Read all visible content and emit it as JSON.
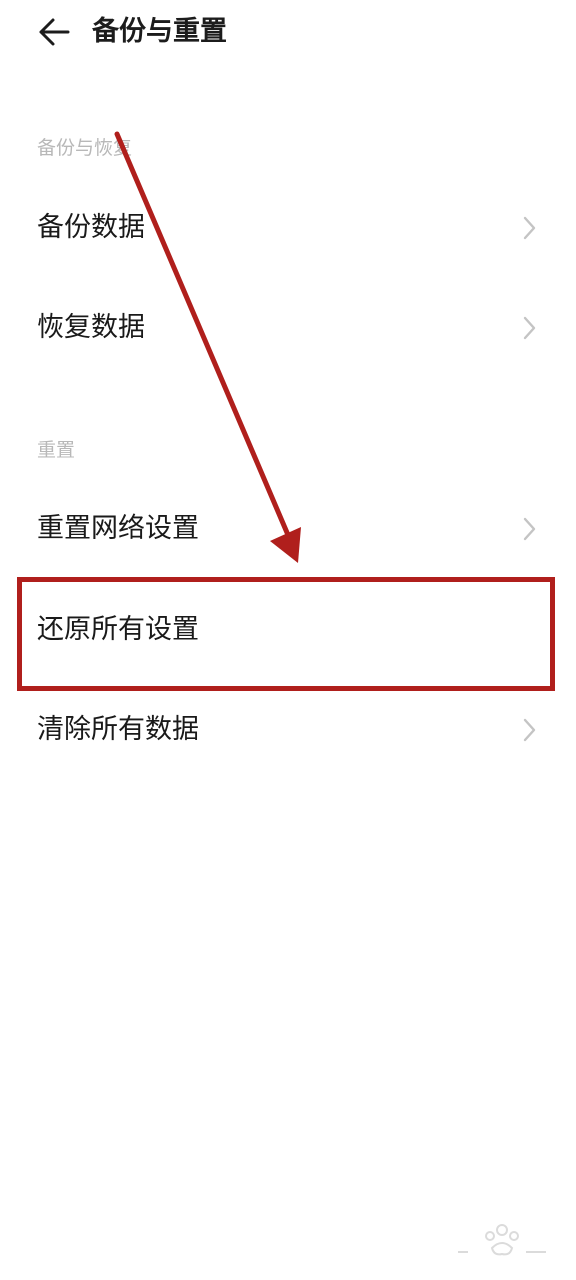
{
  "header": {
    "title": "备份与重置"
  },
  "sections": [
    {
      "title": "备份与恢复",
      "items": [
        {
          "label": "备份数据",
          "chevron": true
        },
        {
          "label": "恢复数据",
          "chevron": true
        }
      ]
    },
    {
      "title": "重置",
      "items": [
        {
          "label": "重置网络设置",
          "chevron": true
        },
        {
          "label": "还原所有设置",
          "chevron": false,
          "highlighted": true
        },
        {
          "label": "清除所有数据",
          "chevron": true
        }
      ]
    }
  ],
  "annotation": {
    "color": "#b01f1c",
    "target": "还原所有设置"
  },
  "colors": {
    "section_header": "#b8b8b8",
    "chevron": "#c4c4c4",
    "text": "#1a1a1a"
  }
}
